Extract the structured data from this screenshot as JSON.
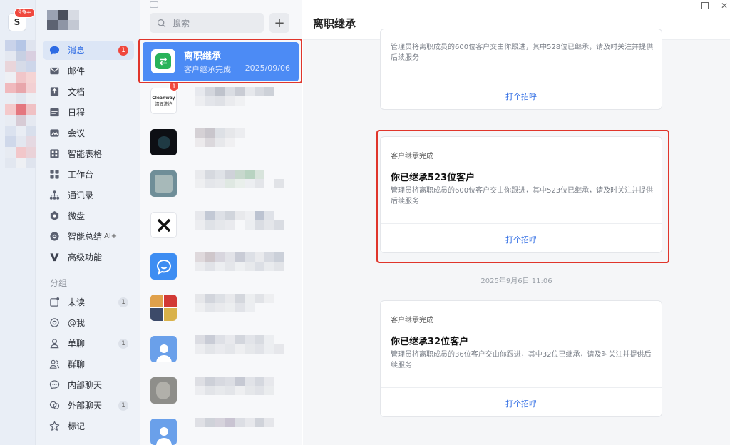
{
  "rail": {
    "logo_letter": "S",
    "unread_badge": "99+"
  },
  "nav": {
    "items": [
      {
        "label": "消息",
        "count": "1"
      },
      {
        "label": "邮件"
      },
      {
        "label": "文档"
      },
      {
        "label": "日程"
      },
      {
        "label": "会议"
      },
      {
        "label": "智能表格"
      },
      {
        "label": "工作台"
      },
      {
        "label": "通讯录"
      },
      {
        "label": "微盘"
      },
      {
        "label": "智能总结",
        "suffix": "AI+"
      },
      {
        "label": "高级功能"
      }
    ],
    "group_title": "分组",
    "groups": [
      {
        "label": "未读",
        "count": "1"
      },
      {
        "label": "@我"
      },
      {
        "label": "单聊",
        "count": "1"
      },
      {
        "label": "群聊"
      },
      {
        "label": "内部聊天"
      },
      {
        "label": "外部聊天",
        "count": "1"
      },
      {
        "label": "标记"
      }
    ]
  },
  "list": {
    "search_placeholder": "搜索",
    "active_conversation": {
      "name": "离职继承",
      "subtitle": "客户继承完成",
      "date": "2025/09/06"
    },
    "cleanway_badge": "1",
    "cleanway_avatar": {
      "line1": "Cleanway",
      "line2": "清辉洗护"
    }
  },
  "chat": {
    "title": "离职继承",
    "messages": [
      {
        "type": "",
        "headline": "",
        "desc": "管理员将离职成员的600位客户交由你跟进，其中528位已继承，请及时关注并提供后续服务",
        "action": "打个招呼"
      },
      {
        "type": "客户继承完成",
        "headline": "你已继承523位客户",
        "desc": "管理员将离职成员的600位客户交由你跟进，其中523位已继承，请及时关注并提供后续服务",
        "action": "打个招呼"
      },
      {
        "type": "客户继承完成",
        "headline": "你已继承32位客户",
        "desc": "管理员将离职成员的36位客户交由你跟进，其中32位已继承，请及时关注并提供后续服务",
        "action": "打个招呼"
      }
    ],
    "timestamp": "2025年9月6日 11:06"
  },
  "colors": {
    "accent": "#2d6be4",
    "active_row": "#4c8bf5",
    "badge": "#f0483e",
    "highlight_box": "#e0352b"
  }
}
